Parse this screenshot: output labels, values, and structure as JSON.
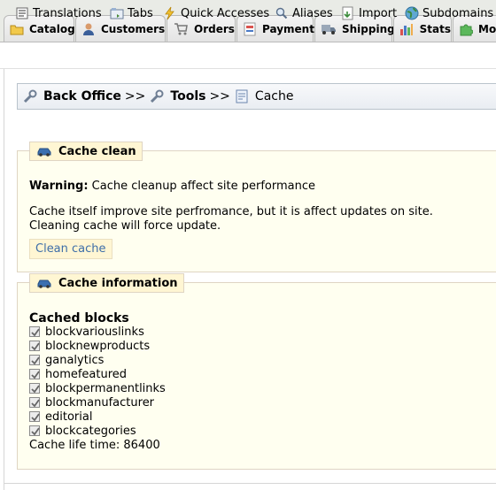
{
  "tabs": [
    {
      "label": "Catalog",
      "icon": "folder-icon"
    },
    {
      "label": "Customers",
      "icon": "customers-icon"
    },
    {
      "label": "Orders",
      "icon": "cart-icon"
    },
    {
      "label": "Payment",
      "icon": "payment-icon"
    },
    {
      "label": "Shipping",
      "icon": "truck-icon"
    },
    {
      "label": "Stats",
      "icon": "chart-icon"
    },
    {
      "label": "Mo",
      "icon": "puzzle-icon"
    }
  ],
  "submenu": [
    {
      "label": "Translations",
      "icon": "translations-icon"
    },
    {
      "label": "Tabs",
      "icon": "tabs-icon"
    },
    {
      "label": "Quick Accesses",
      "icon": "lightning-icon"
    },
    {
      "label": "Aliases",
      "icon": "magnifier-icon"
    },
    {
      "label": "Import",
      "icon": "import-icon"
    },
    {
      "label": "Subdomains",
      "icon": "globe-icon"
    }
  ],
  "breadcrumb": {
    "back_office": "Back Office",
    "sep1": ">>",
    "tools": "Tools",
    "sep2": ">>",
    "current": "Cache"
  },
  "cache_clean": {
    "legend": "Cache clean",
    "warning_label": "Warning:",
    "warning_text": "Cache cleanup affect site performance",
    "description_line1": "Cache itself improve site perfromance, but it is affect updates on site.",
    "description_line2": "Cleaning cache will force update.",
    "button_label": "Clean cache"
  },
  "cache_info": {
    "legend": "Cache information",
    "heading": "Cached blocks",
    "blocks": [
      "blockvariouslinks",
      "blocknewproducts",
      "ganalytics",
      "homefeatured",
      "blockpermanentlinks",
      "blockmanufacturer",
      "editorial",
      "blockcategories"
    ],
    "life_time_label": "Cache life time:",
    "life_time_value": "86400"
  },
  "colors": {
    "legend_bg": "#fff6d3",
    "fieldset_bg": "#fffff0",
    "link_blue": "#3e6ea8"
  }
}
